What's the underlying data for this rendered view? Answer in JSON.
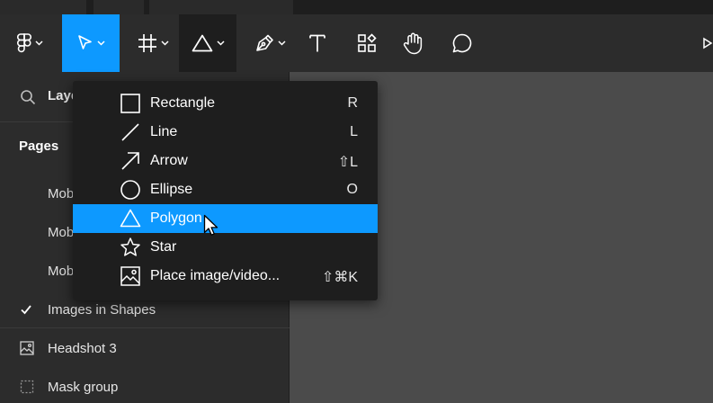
{
  "toolbar": {
    "tools": [
      {
        "name": "main-menu",
        "icon": "figma-logo-icon",
        "state": "normal"
      },
      {
        "name": "move",
        "icon": "pointer-icon",
        "state": "selected"
      },
      {
        "name": "frame",
        "icon": "frame-hash-icon",
        "state": "normal"
      },
      {
        "name": "shape",
        "icon": "triangle-icon",
        "state": "open"
      },
      {
        "name": "pen",
        "icon": "pen-nib-icon",
        "state": "normal"
      },
      {
        "name": "text",
        "icon": "text-t-icon",
        "state": "normal"
      },
      {
        "name": "resources",
        "icon": "components-icon",
        "state": "normal"
      },
      {
        "name": "hand",
        "icon": "hand-icon",
        "state": "normal"
      },
      {
        "name": "comment",
        "icon": "comment-bubble-icon",
        "state": "normal"
      }
    ],
    "text_label": "T"
  },
  "left_panel": {
    "search_label": "Laye",
    "pages_title": "Pages",
    "pages": [
      {
        "label": "Mob"
      },
      {
        "label": "Mob"
      },
      {
        "label": "Mob"
      },
      {
        "label": "Images in Shapes",
        "current": true
      }
    ],
    "layers": [
      {
        "label": "Headshot 3",
        "icon": "image-icon"
      },
      {
        "label": "Mask group",
        "icon": "dotted-frame-icon"
      }
    ]
  },
  "shape_menu": {
    "items": [
      {
        "label": "Rectangle",
        "shortcut": "R",
        "icon": "rectangle-icon"
      },
      {
        "label": "Line",
        "shortcut": "L",
        "icon": "line-icon"
      },
      {
        "label": "Arrow",
        "shortcut": "⇧L",
        "icon": "arrow-icon"
      },
      {
        "label": "Ellipse",
        "shortcut": "O",
        "icon": "ellipse-icon"
      },
      {
        "label": "Polygon",
        "shortcut": "",
        "icon": "polygon-icon",
        "highlighted": true
      },
      {
        "label": "Star",
        "shortcut": "",
        "icon": "star-icon"
      },
      {
        "label": "Place image/video...",
        "shortcut": "⇧⌘K",
        "icon": "place-image-icon"
      }
    ]
  },
  "colors": {
    "accent": "#0d99ff",
    "toolbar_bg": "#2c2c2c",
    "menu_bg": "#1e1e1e",
    "canvas_bg": "#4b4b4b"
  }
}
